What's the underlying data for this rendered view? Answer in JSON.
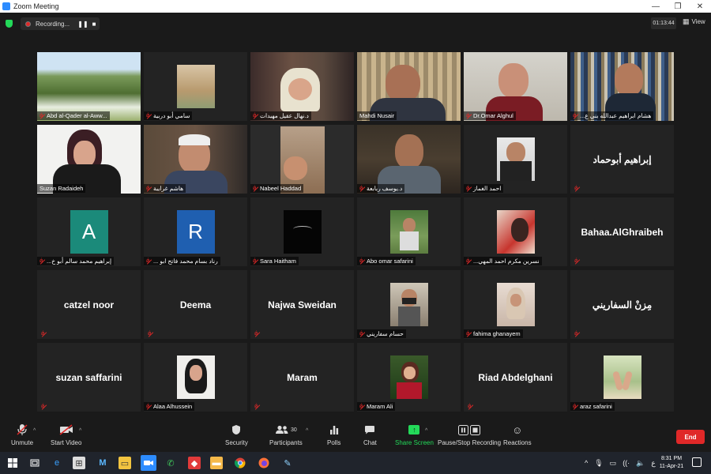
{
  "window": {
    "title": "Zoom Meeting",
    "minimize": "—",
    "maximize": "❐",
    "close": "✕"
  },
  "recording": {
    "label": "Recording...",
    "pause": "❚❚",
    "stop": "■"
  },
  "timer": "01:13:44",
  "view": {
    "label": "View"
  },
  "colors": {
    "accent_green": "#23d959",
    "mute_red": "#e02828",
    "active_speaker": "#c9e86a",
    "end_red": "#e02828"
  },
  "tiles": [
    {
      "name": "Abd al-Qader al-Aww...",
      "kind": "video",
      "muted": true,
      "scene": "landscape"
    },
    {
      "name": "سامي أبو دربية",
      "kind": "thumb",
      "muted": true,
      "scene": "building"
    },
    {
      "name": "د.نهال عقيل مهيدات",
      "kind": "video",
      "muted": true,
      "scene": "woman-hijab"
    },
    {
      "name": "Mahdi Nusair",
      "kind": "video",
      "muted": false,
      "scene": "man-curtain"
    },
    {
      "name": "Dr.Omar Alghul",
      "kind": "video",
      "muted": true,
      "scene": "man-glasses"
    },
    {
      "name": "هشام ابراهيم عبدالله بني ع...",
      "kind": "video",
      "muted": true,
      "scene": "man-bookshelf"
    },
    {
      "name": "Suzan Radaideh",
      "kind": "video",
      "muted": false,
      "active": true,
      "scene": "woman-speaker"
    },
    {
      "name": "هاشم غرايبة",
      "kind": "video",
      "muted": true,
      "scene": "man-white-hair"
    },
    {
      "name": "Nabeel Haddad",
      "kind": "video",
      "muted": true,
      "scene": "man-window"
    },
    {
      "name": "د.يوسف ربابعة",
      "kind": "video",
      "muted": true,
      "scene": "man-dark"
    },
    {
      "name": "احمد الغماز",
      "kind": "thumb",
      "muted": true,
      "scene": "man-suit"
    },
    {
      "name": "إبراهيم أبوحماد",
      "kind": "name",
      "muted": true
    },
    {
      "name": "إبراهيم محمد سالم أبو خ...",
      "kind": "letter",
      "letter": "A",
      "letter_color": "#1b8a7a",
      "muted": true
    },
    {
      "name": "رناد بسام محمد فاتح ابو ...",
      "kind": "letter",
      "letter": "R",
      "letter_color": "#1f5fb0",
      "muted": true
    },
    {
      "name": "Sara Haitham",
      "kind": "thumb",
      "muted": true,
      "scene": "dark-art"
    },
    {
      "name": "Abo omar safarini",
      "kind": "thumb",
      "muted": true,
      "scene": "man-garden"
    },
    {
      "name": "نسرين مكرم احمد المهي...",
      "kind": "thumb",
      "muted": true,
      "scene": "woman-flowers"
    },
    {
      "name": "Bahaa.AlGhraibeh",
      "kind": "name",
      "muted": true
    },
    {
      "name": "catzel noor",
      "kind": "name",
      "muted": true
    },
    {
      "name": "Deema",
      "kind": "name",
      "muted": true
    },
    {
      "name": "Najwa Sweidan",
      "kind": "name",
      "muted": true
    },
    {
      "name": "حسام سفاريني",
      "kind": "thumb",
      "muted": true,
      "scene": "man-mask"
    },
    {
      "name": "fahima ghanayem",
      "kind": "thumb",
      "muted": true,
      "scene": "woman-scarf"
    },
    {
      "name": "مِزنْ السفاريني",
      "kind": "name",
      "muted": true
    },
    {
      "name": "suzan saffarini",
      "kind": "name",
      "muted": true
    },
    {
      "name": "Alaa Alhussein",
      "kind": "thumb",
      "muted": true,
      "scene": "woman-black-hijab"
    },
    {
      "name": "Maram",
      "kind": "name",
      "muted": true
    },
    {
      "name": "Maram Ali",
      "kind": "thumb",
      "muted": true,
      "scene": "woman-red"
    },
    {
      "name": "Riad Abdelghani",
      "kind": "name",
      "muted": true
    },
    {
      "name": "araz safarini",
      "kind": "thumb",
      "muted": true,
      "scene": "hands-nature"
    }
  ],
  "toolbar": {
    "unmute": "Unmute",
    "start_video": "Start Video",
    "security": "Security",
    "participants": "Participants",
    "participants_count": "30",
    "polls": "Polls",
    "chat": "Chat",
    "share_screen": "Share Screen",
    "pause_stop_recording": "Pause/Stop Recording",
    "reactions": "Reactions",
    "end": "End"
  },
  "taskbar": {
    "time": "8:31 PM",
    "date": "11-Apr-21",
    "lang": "ع",
    "apps": [
      "start",
      "task-view",
      "edge",
      "store",
      "mail",
      "explorer",
      "zoom",
      "whatsapp",
      "anydesk",
      "files",
      "chrome",
      "firefox",
      "paint"
    ]
  }
}
